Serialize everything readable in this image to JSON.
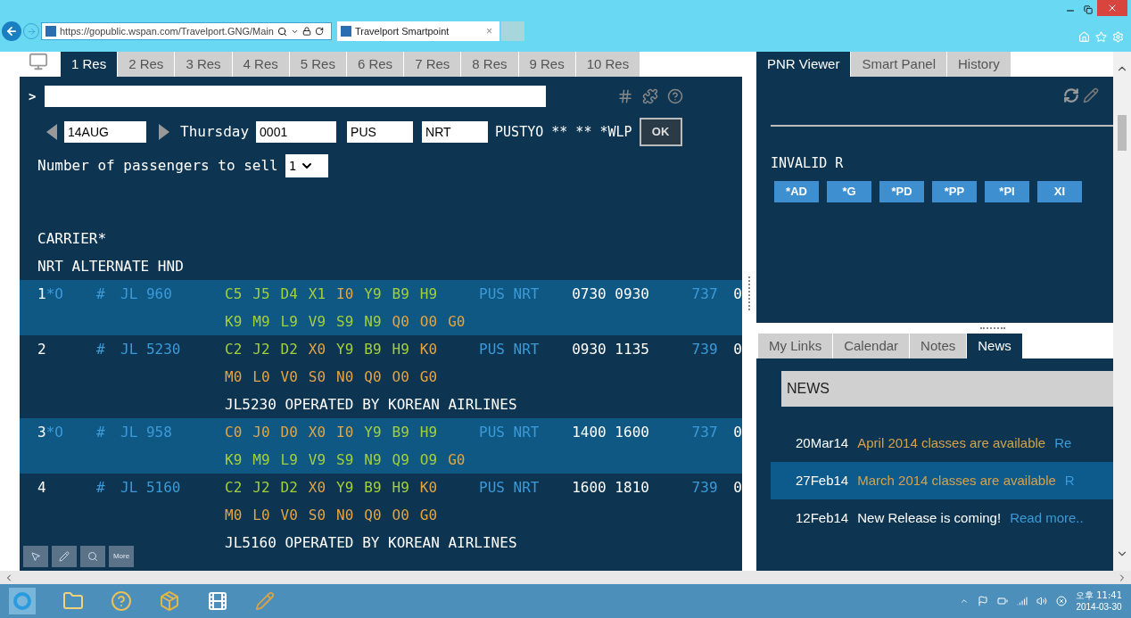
{
  "browser": {
    "url": "https://gopublic.wspan.com/Travelport.GNG/Main",
    "tab_title": "Travelport Smartpoint",
    "tab_close": "×"
  },
  "res_tabs": [
    {
      "label": "1 Res",
      "selected": true
    },
    {
      "label": "2 Res",
      "selected": false
    },
    {
      "label": "3 Res",
      "selected": false
    },
    {
      "label": "4 Res",
      "selected": false
    },
    {
      "label": "5 Res",
      "selected": false
    },
    {
      "label": "6 Res",
      "selected": false
    },
    {
      "label": "7 Res",
      "selected": false
    },
    {
      "label": "8 Res",
      "selected": false
    },
    {
      "label": "9 Res",
      "selected": false
    },
    {
      "label": "10 Res",
      "selected": false
    }
  ],
  "terminal": {
    "prompt": ">",
    "date": "14AUG",
    "day": "Thursday",
    "time": "0001",
    "from": "PUS",
    "to": "NRT",
    "city_pair": "PUSTYO ** ** *WLP",
    "ok": "OK",
    "passengers_label": "Number of passengers to sell",
    "passengers": "1",
    "header_lines": [
      "CARRIER*",
      "NRT ALTERNATE HND"
    ],
    "flights": [
      {
        "number": "1",
        "flag": "*O",
        "selected": true,
        "mark": "#",
        "flight": "JL 960",
        "route": "PUS NRT",
        "times": "0730 0930",
        "equipment": "737",
        "column_9": "0",
        "classes": [
          [
            {
              "code": "C5",
              "color": "#a3cf3c"
            },
            {
              "code": "J5",
              "color": "#a3cf3c"
            },
            {
              "code": "D4",
              "color": "#a3cf3c"
            },
            {
              "code": "X1",
              "color": "#a3cf3c"
            },
            {
              "code": "I0",
              "color": "#e3a444"
            },
            {
              "code": "Y9",
              "color": "#a3cf3c"
            },
            {
              "code": "B9",
              "color": "#a3cf3c"
            },
            {
              "code": "H9",
              "color": "#a3cf3c"
            }
          ],
          [
            {
              "code": "K9",
              "color": "#a3cf3c"
            },
            {
              "code": "M9",
              "color": "#a3cf3c"
            },
            {
              "code": "L9",
              "color": "#a3cf3c"
            },
            {
              "code": "V9",
              "color": "#a3cf3c"
            },
            {
              "code": "S9",
              "color": "#a3cf3c"
            },
            {
              "code": "N9",
              "color": "#a3cf3c"
            },
            {
              "code": "Q0",
              "color": "#e3a444"
            },
            {
              "code": "O0",
              "color": "#e3a444"
            },
            {
              "code": "G0",
              "color": "#e3a444"
            }
          ]
        ]
      },
      {
        "number": "2",
        "selected": false,
        "mark": "#",
        "flight": "JL 5230",
        "route": "PUS NRT",
        "times": "0930 1135",
        "equipment": "739",
        "column_9": "0",
        "note": "JL5230 OPERATED BY KOREAN AIRLINES",
        "classes": [
          [
            {
              "code": "C2",
              "color": "#a3cf3c"
            },
            {
              "code": "J2",
              "color": "#a3cf3c"
            },
            {
              "code": "D2",
              "color": "#a3cf3c"
            },
            {
              "code": "X0",
              "color": "#e3a444"
            },
            {
              "code": "Y9",
              "color": "#a3cf3c"
            },
            {
              "code": "B9",
              "color": "#a3cf3c"
            },
            {
              "code": "H9",
              "color": "#a3cf3c"
            },
            {
              "code": "K0",
              "color": "#e3a444"
            }
          ],
          [
            {
              "code": "M0",
              "color": "#e3a444"
            },
            {
              "code": "L0",
              "color": "#e3a444"
            },
            {
              "code": "V0",
              "color": "#e3a444"
            },
            {
              "code": "S0",
              "color": "#e3a444"
            },
            {
              "code": "N0",
              "color": "#e3a444"
            },
            {
              "code": "Q0",
              "color": "#e3a444"
            },
            {
              "code": "O0",
              "color": "#e3a444"
            },
            {
              "code": "G0",
              "color": "#e3a444"
            }
          ]
        ]
      },
      {
        "number": "3",
        "flag": "*O",
        "selected": true,
        "mark": "#",
        "flight": "JL 958",
        "route": "PUS NRT",
        "times": "1400 1600",
        "equipment": "737",
        "column_9": "0",
        "classes": [
          [
            {
              "code": "C0",
              "color": "#e3a444"
            },
            {
              "code": "J0",
              "color": "#e3a444"
            },
            {
              "code": "D0",
              "color": "#e3a444"
            },
            {
              "code": "X0",
              "color": "#e3a444"
            },
            {
              "code": "I0",
              "color": "#e3a444"
            },
            {
              "code": "Y9",
              "color": "#a3cf3c"
            },
            {
              "code": "B9",
              "color": "#a3cf3c"
            },
            {
              "code": "H9",
              "color": "#a3cf3c"
            }
          ],
          [
            {
              "code": "K9",
              "color": "#a3cf3c"
            },
            {
              "code": "M9",
              "color": "#a3cf3c"
            },
            {
              "code": "L9",
              "color": "#a3cf3c"
            },
            {
              "code": "V9",
              "color": "#a3cf3c"
            },
            {
              "code": "S9",
              "color": "#a3cf3c"
            },
            {
              "code": "N9",
              "color": "#a3cf3c"
            },
            {
              "code": "Q9",
              "color": "#a3cf3c"
            },
            {
              "code": "O9",
              "color": "#a3cf3c"
            },
            {
              "code": "G0",
              "color": "#e3a444"
            }
          ]
        ]
      },
      {
        "number": "4",
        "selected": false,
        "mark": "#",
        "flight": "JL 5160",
        "route": "PUS NRT",
        "times": "1600 1810",
        "equipment": "739",
        "column_9": "0",
        "note": "JL5160 OPERATED BY KOREAN AIRLINES",
        "classes": [
          [
            {
              "code": "C2",
              "color": "#a3cf3c"
            },
            {
              "code": "J2",
              "color": "#a3cf3c"
            },
            {
              "code": "D2",
              "color": "#a3cf3c"
            },
            {
              "code": "X0",
              "color": "#e3a444"
            },
            {
              "code": "Y9",
              "color": "#a3cf3c"
            },
            {
              "code": "B9",
              "color": "#a3cf3c"
            },
            {
              "code": "H9",
              "color": "#a3cf3c"
            },
            {
              "code": "K0",
              "color": "#e3a444"
            }
          ],
          [
            {
              "code": "M0",
              "color": "#e3a444"
            },
            {
              "code": "L0",
              "color": "#e3a444"
            },
            {
              "code": "V0",
              "color": "#e3a444"
            },
            {
              "code": "S0",
              "color": "#e3a444"
            },
            {
              "code": "N0",
              "color": "#e3a444"
            },
            {
              "code": "Q0",
              "color": "#e3a444"
            },
            {
              "code": "O0",
              "color": "#e3a444"
            },
            {
              "code": "G0",
              "color": "#e3a444"
            }
          ]
        ]
      }
    ],
    "tools_more": "More"
  },
  "side_tabs": [
    {
      "label": "PNR Viewer",
      "selected": true
    },
    {
      "label": "Smart Panel",
      "selected": false
    },
    {
      "label": "History",
      "selected": false
    }
  ],
  "pnr": {
    "message": "INVALID R",
    "buttons": [
      "*AD",
      "*G",
      "*PD",
      "*PP",
      "*PI",
      "XI"
    ]
  },
  "bottom_tabs": [
    {
      "label": "My Links",
      "selected": false
    },
    {
      "label": "Calendar",
      "selected": false
    },
    {
      "label": "Notes",
      "selected": false
    },
    {
      "label": "News",
      "selected": true
    }
  ],
  "news": {
    "heading": "NEWS",
    "items": [
      {
        "date": "20Mar14",
        "title": "April 2014 classes are available",
        "color": "#d4a24a",
        "link": "Re",
        "selected": false
      },
      {
        "date": "27Feb14",
        "title": "March 2014 classes are available",
        "color": "#d4a24a",
        "link": "R",
        "selected": true
      },
      {
        "date": "12Feb14",
        "title": "New Release is coming!",
        "color": "#ffffff",
        "link": "Read more..",
        "selected": false
      }
    ]
  },
  "taskbar": {
    "time": "오후 11:41",
    "date": "2014-03-30"
  }
}
